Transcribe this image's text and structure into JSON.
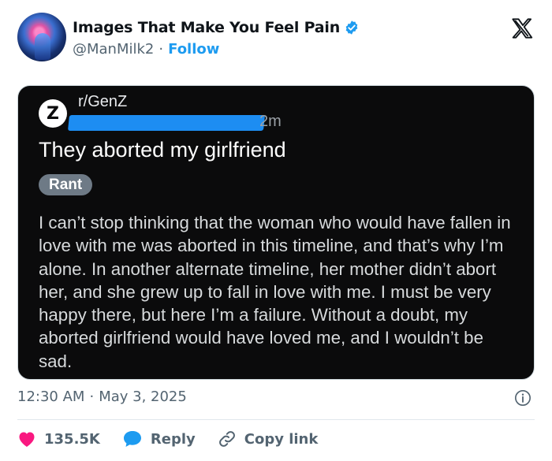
{
  "author": {
    "display_name": "Images That Make You Feel Pain",
    "handle": "@ManMilk2",
    "separator": "·",
    "follow_label": "Follow",
    "verified_color": "#1d9bf0"
  },
  "embedded_post": {
    "subreddit_icon_letter": "Z",
    "subreddit": "r/GenZ",
    "time_ago": "2m",
    "title": "They aborted my girlfriend",
    "flair": "Rant",
    "body": "I can’t stop thinking that the woman who would have fallen in love with me was aborted in this timeline, and that’s why I’m alone. In another alternate timeline, her mother didn’t abort her, and she grew up to fall in love with me. I must be very happy there, but here I’m a failure. Without a doubt, my aborted girlfriend would have loved me, and I wouldn’t be sad.",
    "redaction_color": "#1d8df2"
  },
  "meta": {
    "time": "12:30 AM",
    "separator": "·",
    "date": "May 3, 2025"
  },
  "actions": {
    "like_count": "135.5K",
    "reply_label": "Reply",
    "copy_link_label": "Copy link",
    "like_color": "#f91880",
    "reply_color": "#1d9bf0"
  },
  "icons": {
    "verified": "verified-badge-icon",
    "platform": "x-logo-icon",
    "info": "info-icon",
    "like": "heart-icon",
    "reply": "speech-bubble-icon",
    "link": "link-icon"
  }
}
